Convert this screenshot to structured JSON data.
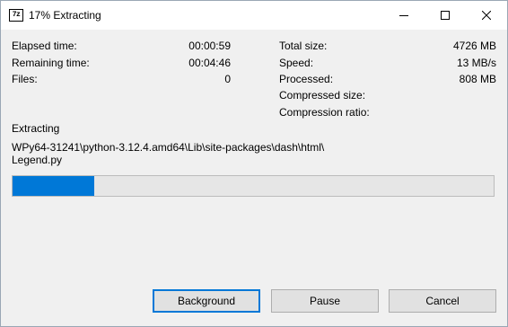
{
  "window": {
    "title": "17% Extracting",
    "icon_name": "7zip-app-icon",
    "icon_text": "7z"
  },
  "stats_left": [
    {
      "label": "Elapsed time:",
      "value": "00:00:59"
    },
    {
      "label": "Remaining time:",
      "value": "00:04:46"
    },
    {
      "label": "Files:",
      "value": "0"
    }
  ],
  "stats_right": [
    {
      "label": "Total size:",
      "value": "4726 MB"
    },
    {
      "label": "Speed:",
      "value": "13 MB/s"
    },
    {
      "label": "Processed:",
      "value": "808 MB"
    },
    {
      "label": "Compressed size:",
      "value": ""
    },
    {
      "label": "Compression ratio:",
      "value": ""
    }
  ],
  "operation": {
    "label": "Extracting",
    "path_line1": "WPy64-31241\\python-3.12.4.amd64\\Lib\\site-packages\\dash\\html\\",
    "path_line2": "Legend.py"
  },
  "progress": {
    "fraction": 0.17,
    "color": "#0078d7"
  },
  "buttons": {
    "background": "Background",
    "pause": "Pause",
    "cancel": "Cancel"
  }
}
